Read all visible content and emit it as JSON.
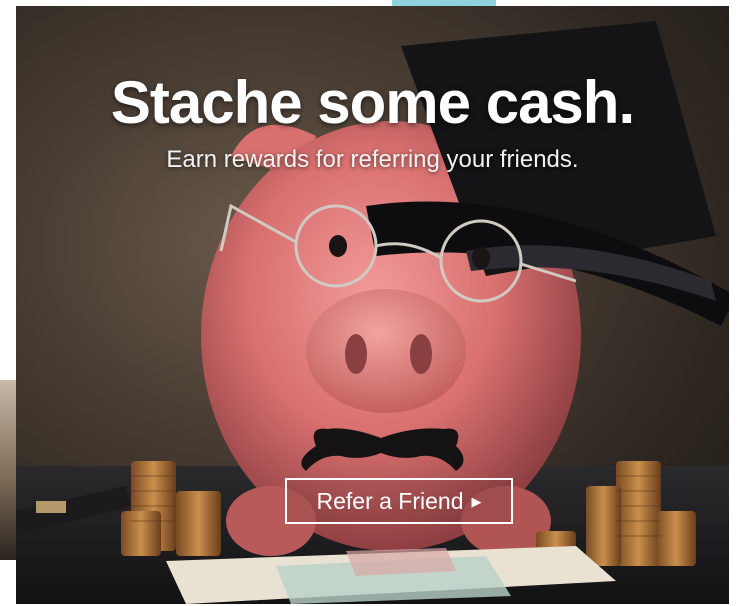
{
  "banner": {
    "headline": "Stache some cash.",
    "subheadline": "Earn rewards for referring your friends.",
    "cta_label": "Refer a Friend",
    "cta_icon": "play-arrow-icon",
    "image_subject": "piggy-bank-with-top-hat-glasses-mustache"
  },
  "colors": {
    "text": "#ffffff",
    "piggy_pink": "#e07f82",
    "background_dark": "#2e2721",
    "accent_tab": "#8fd3df"
  }
}
